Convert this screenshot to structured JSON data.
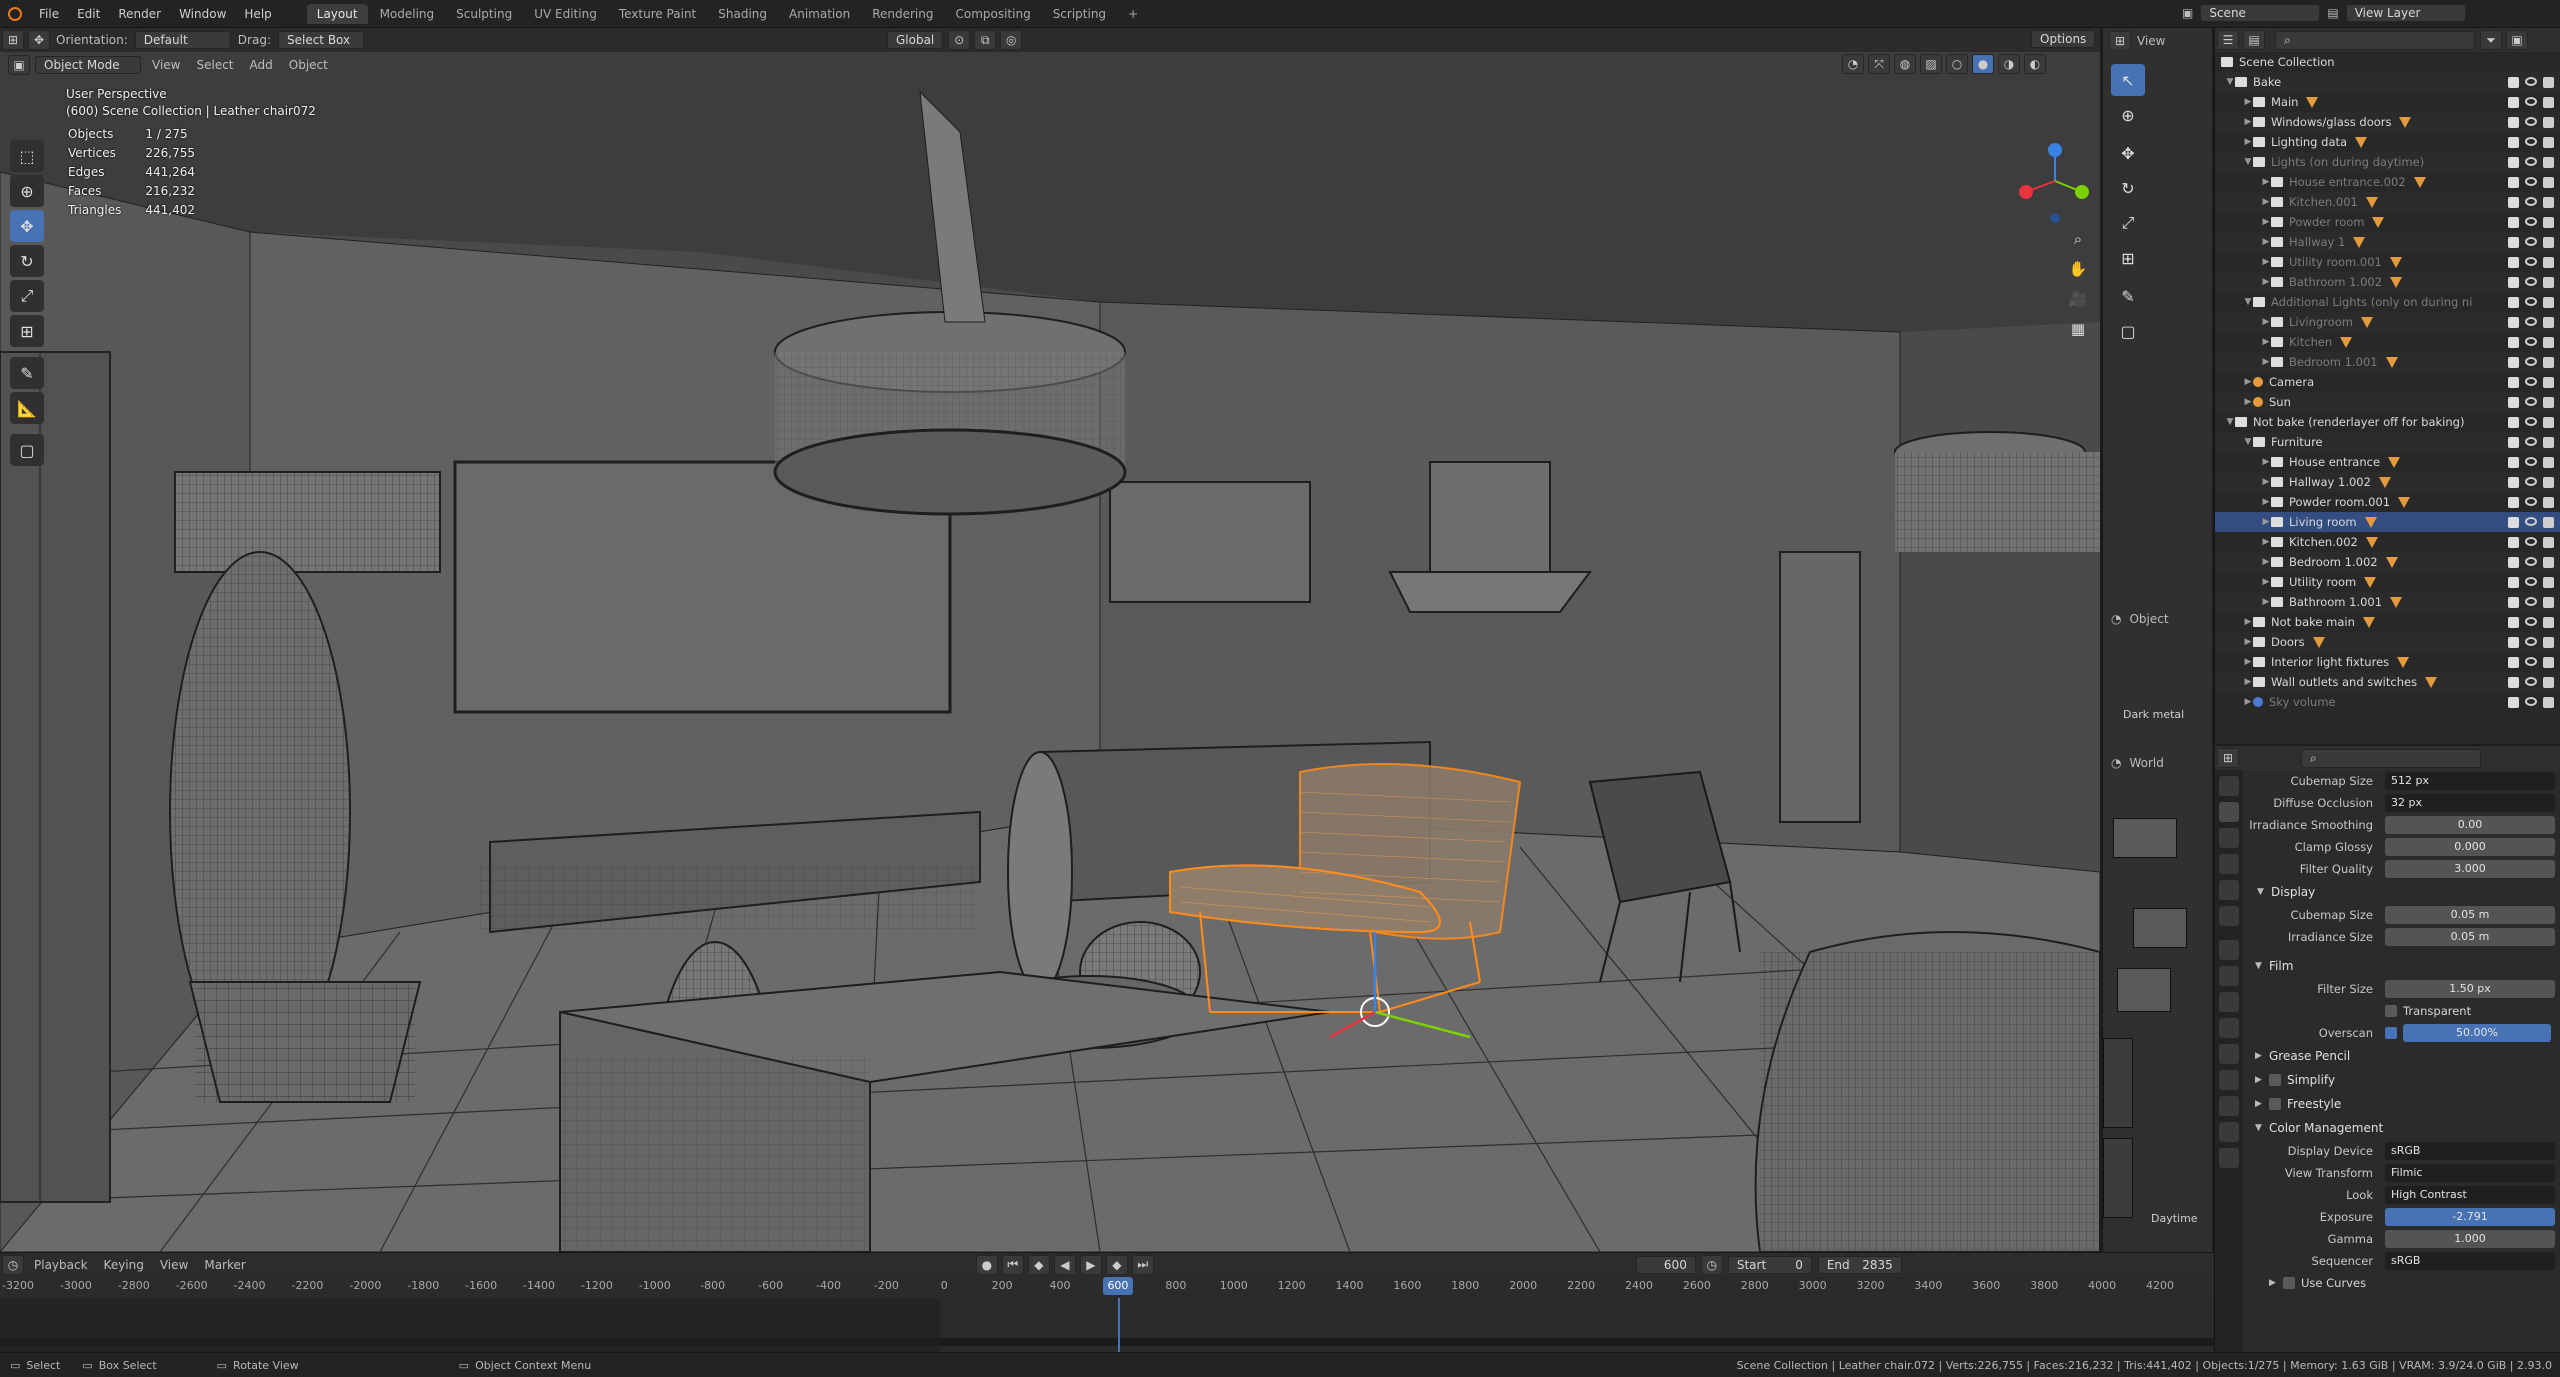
{
  "topbar": {
    "menus": [
      "File",
      "Edit",
      "Render",
      "Window",
      "Help"
    ],
    "workspaces": [
      "Layout",
      "Modeling",
      "Sculpting",
      "UV Editing",
      "Texture Paint",
      "Shading",
      "Animation",
      "Rendering",
      "Compositing",
      "Scripting"
    ],
    "active_workspace": "Layout",
    "add_tab": "+",
    "scene_label": "Scene",
    "view_layer_label": "View Layer"
  },
  "viewport_header": {
    "orientation_label": "Orientation:",
    "orientation_value": "Default",
    "drag_label": "Drag:",
    "drag_value": "Select Box",
    "transform_space": "Global",
    "options_label": "Options",
    "mode": "Object Mode",
    "menu": [
      "View",
      "Select",
      "Add",
      "Object"
    ]
  },
  "overlay": {
    "perspective": "User Perspective",
    "collection": "(600) Scene Collection | Leather chair072",
    "stats": [
      {
        "k": "Objects",
        "v": "1 / 275"
      },
      {
        "k": "Vertices",
        "v": "226,755"
      },
      {
        "k": "Edges",
        "v": "441,264"
      },
      {
        "k": "Faces",
        "v": "216,232"
      },
      {
        "k": "Triangles",
        "v": "441,402"
      }
    ]
  },
  "midcol": {
    "view": "View",
    "object_label": "Object",
    "material_name": "Dark metal",
    "world_label": "World",
    "world_name": "Daytime"
  },
  "outliner": {
    "root": "Scene Collection",
    "items": [
      {
        "label": "Bake",
        "depth": 0,
        "type": "coll",
        "open": true
      },
      {
        "label": "Main",
        "depth": 1,
        "type": "coll"
      },
      {
        "label": "Windows/glass doors",
        "depth": 1,
        "type": "coll"
      },
      {
        "label": "Lighting data",
        "depth": 1,
        "type": "coll"
      },
      {
        "label": "Lights (on during daytime)",
        "depth": 1,
        "type": "coll",
        "dim": true,
        "open": true
      },
      {
        "label": "House entrance.002",
        "depth": 2,
        "type": "coll",
        "dim": true
      },
      {
        "label": "Kitchen.001",
        "depth": 2,
        "type": "coll",
        "dim": true
      },
      {
        "label": "Powder room",
        "depth": 2,
        "type": "coll",
        "dim": true
      },
      {
        "label": "Hallway 1",
        "depth": 2,
        "type": "coll",
        "dim": true
      },
      {
        "label": "Utility room.001",
        "depth": 2,
        "type": "coll",
        "dim": true
      },
      {
        "label": "Bathroom 1.002",
        "depth": 2,
        "type": "coll",
        "dim": true
      },
      {
        "label": "Additional Lights (only on during ni",
        "depth": 1,
        "type": "coll",
        "dim": true,
        "open": true
      },
      {
        "label": "Livingroom",
        "depth": 2,
        "type": "coll",
        "dim": true
      },
      {
        "label": "Kitchen",
        "depth": 2,
        "type": "coll",
        "dim": true
      },
      {
        "label": "Bedroom 1.001",
        "depth": 2,
        "type": "coll",
        "dim": true
      },
      {
        "label": "Camera",
        "depth": 1,
        "type": "obj"
      },
      {
        "label": "Sun",
        "depth": 1,
        "type": "obj"
      },
      {
        "label": "Not bake (renderlayer off for baking)",
        "depth": 0,
        "type": "coll",
        "open": true
      },
      {
        "label": "Furniture",
        "depth": 1,
        "type": "coll",
        "open": true
      },
      {
        "label": "House entrance",
        "depth": 2,
        "type": "coll"
      },
      {
        "label": "Hallway 1.002",
        "depth": 2,
        "type": "coll"
      },
      {
        "label": "Powder room.001",
        "depth": 2,
        "type": "coll"
      },
      {
        "label": "Living room",
        "depth": 2,
        "type": "coll"
      },
      {
        "label": "Kitchen.002",
        "depth": 2,
        "type": "coll"
      },
      {
        "label": "Bedroom 1.002",
        "depth": 2,
        "type": "coll"
      },
      {
        "label": "Utility room",
        "depth": 2,
        "type": "coll"
      },
      {
        "label": "Bathroom 1.001",
        "depth": 2,
        "type": "coll"
      },
      {
        "label": "Not bake main",
        "depth": 1,
        "type": "coll"
      },
      {
        "label": "Doors",
        "depth": 1,
        "type": "coll"
      },
      {
        "label": "Interior light fixtures",
        "depth": 1,
        "type": "coll"
      },
      {
        "label": "Wall outlets and switches",
        "depth": 1,
        "type": "coll"
      },
      {
        "label": "Sky volume",
        "depth": 1,
        "type": "obj",
        "dim": true
      }
    ]
  },
  "properties": {
    "rows_top": [
      {
        "label": "Cubemap Size",
        "value": "512 px",
        "kind": "dark"
      },
      {
        "label": "Diffuse Occlusion",
        "value": "32 px",
        "kind": "dark"
      },
      {
        "label": "Irradiance Smoothing",
        "value": "0.00",
        "kind": "num"
      },
      {
        "label": "Clamp Glossy",
        "value": "0.000",
        "kind": "num"
      },
      {
        "label": "Filter Quality",
        "value": "3.000",
        "kind": "num"
      }
    ],
    "display_section": "Display",
    "display_rows": [
      {
        "label": "Cubemap Size",
        "value": "0.05 m"
      },
      {
        "label": "Irradiance Size",
        "value": "0.05 m"
      }
    ],
    "film_section": "Film",
    "film_filter_label": "Filter Size",
    "film_filter_value": "1.50 px",
    "transparent_label": "Transparent",
    "overscan_label": "Overscan",
    "overscan_value": "50.00%",
    "collapsed_sections": [
      "Grease Pencil",
      "Simplify",
      "Freestyle"
    ],
    "color_mgmt_section": "Color Management",
    "cm_rows": [
      {
        "label": "Display Device",
        "value": "sRGB",
        "kind": "dark"
      },
      {
        "label": "View Transform",
        "value": "Filmic",
        "kind": "dark"
      },
      {
        "label": "Look",
        "value": "High Contrast",
        "kind": "dark"
      },
      {
        "label": "Exposure",
        "value": "-2.791",
        "kind": "blue"
      },
      {
        "label": "Gamma",
        "value": "1.000",
        "kind": "num"
      },
      {
        "label": "Sequencer",
        "value": "sRGB",
        "kind": "dark"
      }
    ],
    "use_curves_label": "Use Curves"
  },
  "timeline": {
    "menus": [
      "Playback",
      "Keying",
      "View",
      "Marker"
    ],
    "current_frame": "600",
    "start_label": "Start",
    "start_value": "0",
    "end_label": "End",
    "end_value": "2835",
    "ticks": [
      "-3200",
      "-3000",
      "-2800",
      "-2600",
      "-2400",
      "-2200",
      "-2000",
      "-1800",
      "-1600",
      "-1400",
      "-1200",
      "-1000",
      "-800",
      "-600",
      "-400",
      "-200",
      "0",
      "200",
      "400",
      "600",
      "800",
      "1000",
      "1200",
      "1400",
      "1600",
      "1800",
      "2000",
      "2200",
      "2400",
      "2600",
      "2800",
      "3000",
      "3200",
      "3400",
      "3600",
      "3800",
      "4000",
      "4200"
    ]
  },
  "statusbar": {
    "select": "Select",
    "box_select": "Box Select",
    "rotate_view": "Rotate View",
    "context_menu": "Object Context Menu",
    "info": "Scene Collection | Leather chair.072 | Verts:226,755 | Faces:216,232 | Tris:441,402 | Objects:1/275 | Memory: 1.63 GiB | VRAM: 3.9/24.0 GiB | 2.93.0"
  },
  "colors": {
    "accent": "#4772b3",
    "selection": "#e87d0d",
    "viewport_bg": "#4a4a4a"
  }
}
